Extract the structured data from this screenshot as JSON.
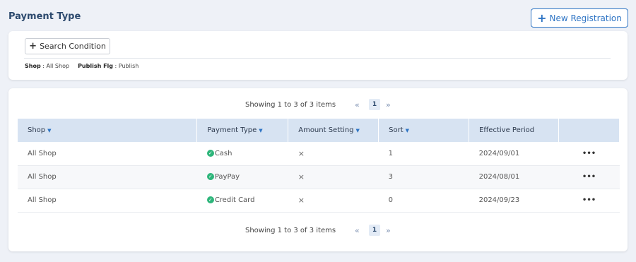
{
  "page": {
    "title": "Payment Type",
    "new_registration_label": "New Registration"
  },
  "search": {
    "button_label": "Search Condition",
    "filters": [
      {
        "key": "Shop",
        "value": "All Shop"
      },
      {
        "key": "Publish Flg",
        "value": "Publish"
      }
    ]
  },
  "pager": {
    "showing_text": "Showing 1 to 3 of 3 items",
    "current_page": "1",
    "first_icon": "«",
    "last_icon": "»"
  },
  "table": {
    "columns": [
      "Shop",
      "Payment Type",
      "Amount Setting",
      "Sort",
      "Effective Period",
      ""
    ],
    "rows": [
      {
        "shop": "All Shop",
        "payment_type": "Cash",
        "amount_setting": "×",
        "sort": "1",
        "effective_period": "2024/09/01",
        "menu": "•••"
      },
      {
        "shop": "All Shop",
        "payment_type": "PayPay",
        "amount_setting": "×",
        "sort": "3",
        "effective_period": "2024/08/01",
        "menu": "•••"
      },
      {
        "shop": "All Shop",
        "payment_type": "Credit Card",
        "amount_setting": "×",
        "sort": "0",
        "effective_period": "2024/09/23",
        "menu": "•••"
      }
    ]
  },
  "colors": {
    "accent": "#2e74c4",
    "header_bg": "#d7e3f2",
    "success": "#2db57a"
  }
}
